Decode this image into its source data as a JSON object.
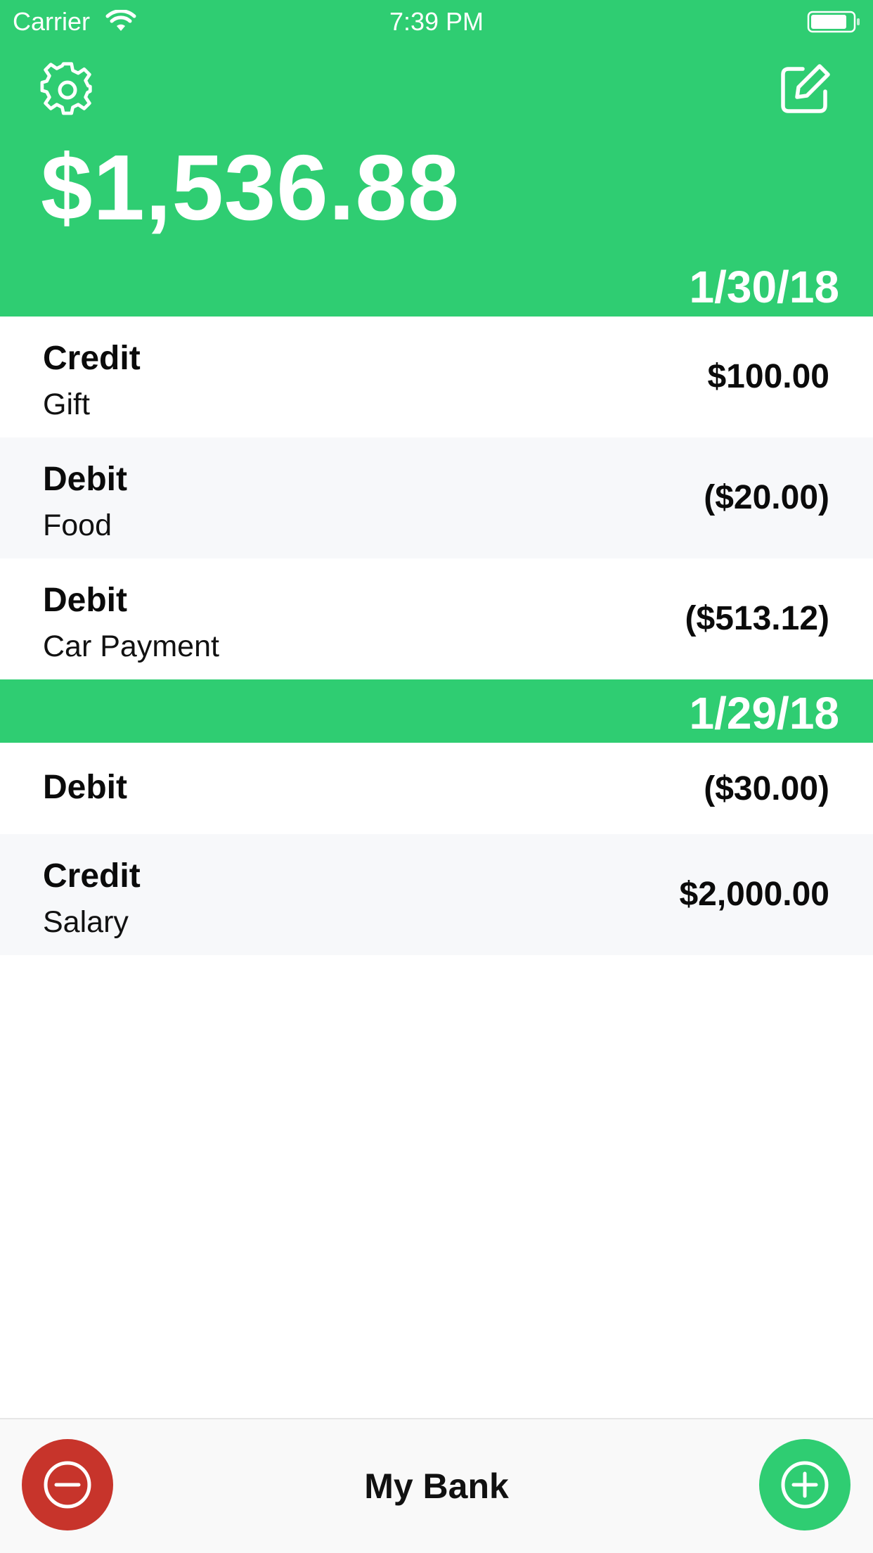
{
  "status_bar": {
    "carrier": "Carrier",
    "time": "7:39 PM"
  },
  "header": {
    "balance": "$1,536.88",
    "settings_icon": "gear-icon",
    "edit_icon": "edit-icon"
  },
  "groups": [
    {
      "date": "1/30/18",
      "transactions": [
        {
          "type": "Credit",
          "description": "Gift",
          "amount": "$100.00"
        },
        {
          "type": "Debit",
          "description": "Food",
          "amount": "($20.00)"
        },
        {
          "type": "Debit",
          "description": "Car Payment",
          "amount": "($513.12)"
        }
      ]
    },
    {
      "date": "1/29/18",
      "transactions": [
        {
          "type": "Debit",
          "description": "",
          "amount": "($30.00)"
        },
        {
          "type": "Credit",
          "description": "Salary",
          "amount": "$2,000.00"
        }
      ]
    }
  ],
  "bottom_bar": {
    "title": "My Bank",
    "withdraw_icon": "minus-circle-icon",
    "deposit_icon": "plus-circle-icon"
  },
  "colors": {
    "brand_green": "#2fcd72",
    "withdraw_red": "#c7342b",
    "alt_row": "#f7f8fa"
  }
}
